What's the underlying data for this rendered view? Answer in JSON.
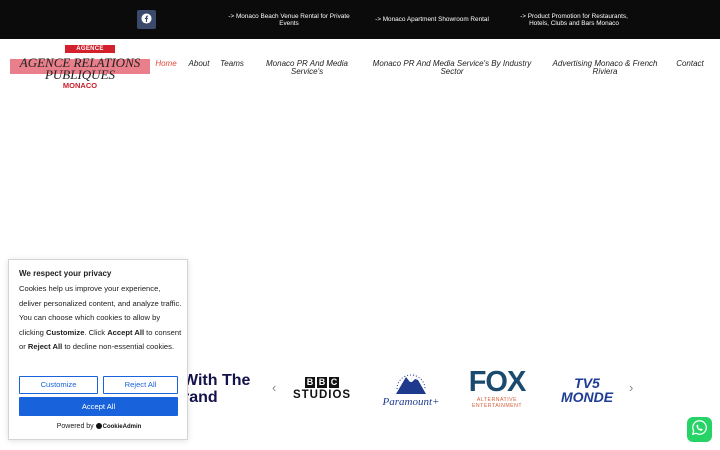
{
  "topbar": {
    "facebook_icon": "facebook-icon",
    "links": [
      "-> Monaco Beach Venue Rental for Private Events",
      "-> Monaco Apartment Showroom Rental",
      "-> Product Promotion for Restaurants, Hotels, Clubs and Bars Monaco"
    ]
  },
  "logo": {
    "top": "AGENCE",
    "line1": "AGENCE RELATIONS",
    "line2": "PUBLIQUES",
    "bottom": "MONACO"
  },
  "nav": {
    "items": [
      "Home",
      "About",
      "Teams",
      "Monaco PR And Media Service's",
      "Monaco PR And Media Service's By Industry Sector",
      "Advertising Monaco & French Riviera",
      "Contact"
    ],
    "active": "Home"
  },
  "partners": {
    "heading_line1": "With The",
    "heading_line2": "rand",
    "prev_arrow": "‹",
    "next_arrow": "›",
    "bbc_letters": [
      "B",
      "B",
      "C"
    ],
    "bbc_label": "STUDIOS",
    "paramount_label": "Paramount+",
    "fox_main": "FOX",
    "fox_sub1": "ALTERNATIVE",
    "fox_sub2": "ENTERTAINMENT",
    "tv5_line1": "TV5",
    "tv5_line2": "MONDE"
  },
  "cookie": {
    "title": "We respect your privacy",
    "body_1": "Cookies help us improve your experience, deliver personalized content, and analyze traffic. You can choose which cookies to allow by clicking ",
    "body_customize": "Customize",
    "body_2": ". Click ",
    "body_accept": "Accept All",
    "body_3": " to consent or ",
    "body_reject": "Reject All",
    "body_4": " to decline non-essential cookies.",
    "customize_button": "Customize",
    "reject_button": "Reject All",
    "accept_button": "Accept All",
    "powered_by": "Powered by",
    "brand": "CookieAdmin"
  },
  "whatsapp_icon": "whatsapp-icon",
  "colors": {
    "topbar": "#0b0b0b",
    "nav_active": "#e0483b",
    "cookie_primary": "#1863dc",
    "whatsapp": "#25d366"
  }
}
